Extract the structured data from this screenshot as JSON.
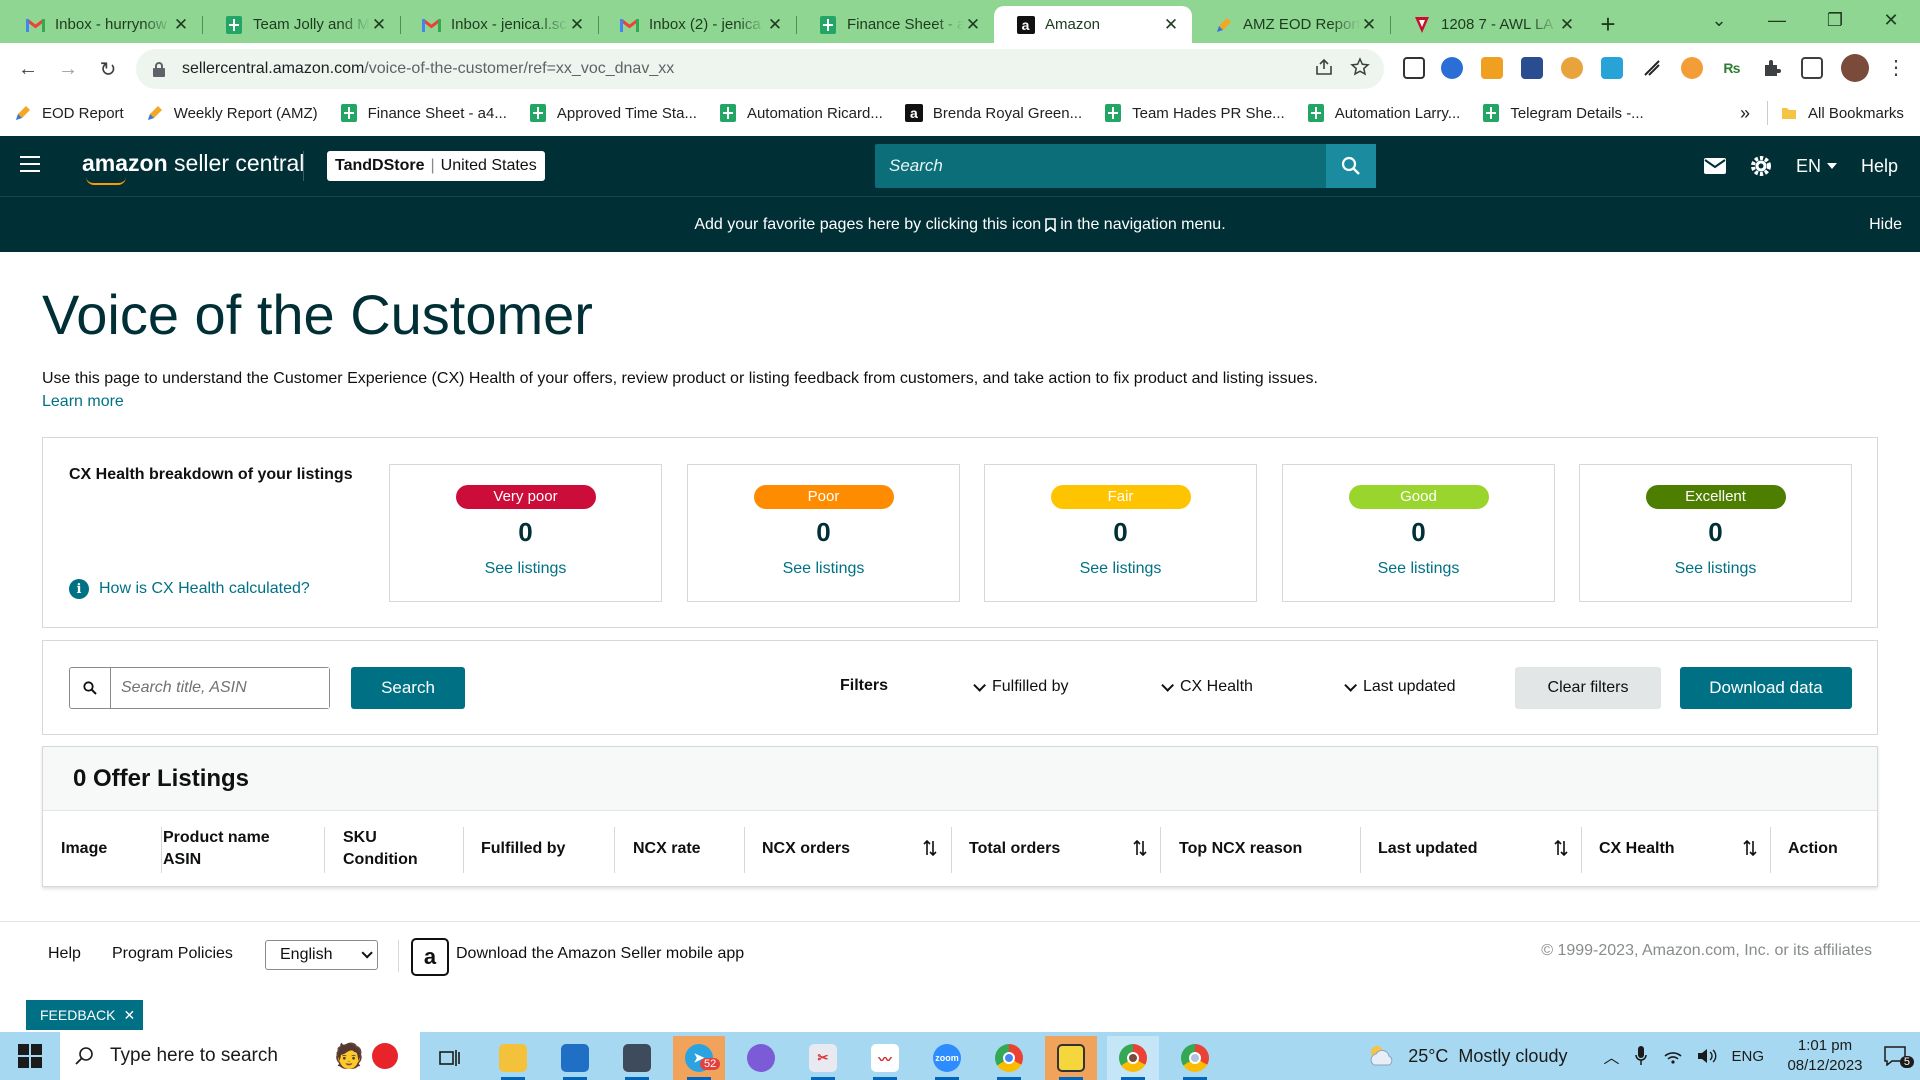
{
  "browser": {
    "tabs": [
      {
        "title": "Inbox - hurrynow",
        "icon": "gmail-icon",
        "active": false
      },
      {
        "title": "Team Jolly and M",
        "icon": "sheets-icon",
        "active": false
      },
      {
        "title": "Inbox - jenica.l.sc",
        "icon": "gmail-icon",
        "active": false
      },
      {
        "title": "Inbox (2) - jenica",
        "icon": "gmail-icon",
        "active": false
      },
      {
        "title": "Finance Sheet - a",
        "icon": "sheets-icon",
        "active": false
      },
      {
        "title": "Amazon",
        "icon": "amazon-icon",
        "active": true
      },
      {
        "title": "AMZ EOD Report",
        "icon": "pen-icon",
        "active": false
      },
      {
        "title": "1208 7 - AWL LA",
        "icon": "shield-icon",
        "active": false
      }
    ],
    "new_tab_label": "+",
    "url_host": "sellercentral.amazon.com",
    "url_path": "/voice-of-the-customer/ref=xx_voc_dnav_xx",
    "bookmarks": [
      {
        "label": "EOD Report",
        "icon": "pen-icon"
      },
      {
        "label": "Weekly Report (AMZ)",
        "icon": "pen-icon"
      },
      {
        "label": "Finance Sheet - a4...",
        "icon": "sheets-icon"
      },
      {
        "label": "Approved Time Sta...",
        "icon": "sheets-icon"
      },
      {
        "label": "Automation Ricard...",
        "icon": "sheets-icon"
      },
      {
        "label": "Brenda Royal Green...",
        "icon": "amazon-icon"
      },
      {
        "label": "Team Hades PR She...",
        "icon": "sheets-icon"
      },
      {
        "label": "Automation Larry...",
        "icon": "sheets-icon"
      },
      {
        "label": "Telegram Details -...",
        "icon": "sheets-icon"
      }
    ],
    "bookmarks_overflow": "»",
    "all_bookmarks": "All Bookmarks"
  },
  "header": {
    "logo_amazon": "amazon",
    "logo_rest": " seller central",
    "store_name": "TandDStore",
    "store_region": "United States",
    "search_placeholder": "Search",
    "language": "EN",
    "help": "Help"
  },
  "banner": {
    "text_before": "Add your favorite pages here by clicking this icon",
    "text_after": "in the navigation menu.",
    "hide": "Hide"
  },
  "page": {
    "title": "Voice of the Customer",
    "description": "Use this page to understand the Customer Experience (CX) Health of your offers, review product or listing feedback from customers, and take action to fix product and listing issues.",
    "learn_more": "Learn more"
  },
  "cx_health": {
    "title": "CX Health breakdown of your listings",
    "how_link": "How is CX Health calculated?",
    "cards": [
      {
        "label": "Very poor",
        "count": "0",
        "link": "See listings",
        "color": "#cc0c39",
        "text_color": "#ffffff"
      },
      {
        "label": "Poor",
        "count": "0",
        "link": "See listings",
        "color": "#ff8c00",
        "text_color": "#ffffff"
      },
      {
        "label": "Fair",
        "count": "0",
        "link": "See listings",
        "color": "#ffc400",
        "text_color": "#ffffff"
      },
      {
        "label": "Good",
        "count": "0",
        "link": "See listings",
        "color": "#9ad52d",
        "text_color": "#ffffff"
      },
      {
        "label": "Excellent",
        "count": "0",
        "link": "See listings",
        "color": "#4d7e00",
        "text_color": "#ffffff"
      }
    ]
  },
  "filters": {
    "search_placeholder": "Search title, ASIN",
    "search_button": "Search",
    "label": "Filters",
    "dropdowns": [
      "Fulfilled by",
      "CX Health",
      "Last updated"
    ],
    "clear": "Clear filters",
    "download": "Download data"
  },
  "listings": {
    "heading": "0 Offer Listings",
    "columns": [
      {
        "line1": "Image",
        "line2": "",
        "sortable": false
      },
      {
        "line1": "Product name",
        "line2": "ASIN",
        "sortable": false
      },
      {
        "line1": "SKU",
        "line2": "Condition",
        "sortable": false
      },
      {
        "line1": "Fulfilled by",
        "line2": "",
        "sortable": false
      },
      {
        "line1": "NCX rate",
        "line2": "",
        "sortable": false
      },
      {
        "line1": "NCX orders",
        "line2": "",
        "sortable": true
      },
      {
        "line1": "Total orders",
        "line2": "",
        "sortable": true
      },
      {
        "line1": "Top NCX reason",
        "line2": "",
        "sortable": false
      },
      {
        "line1": "Last updated",
        "line2": "",
        "sortable": true
      },
      {
        "line1": "CX Health",
        "line2": "",
        "sortable": true
      },
      {
        "line1": "Action",
        "line2": "",
        "sortable": false
      }
    ]
  },
  "footer": {
    "help": "Help",
    "program_policies": "Program Policies",
    "language": "English",
    "app_text": "Download the Amazon Seller mobile app",
    "copyright": "© 1999-2023, Amazon.com, Inc. or its affiliates",
    "feedback": "FEEDBACK"
  },
  "taskbar": {
    "search_placeholder": "Type here to search",
    "telegram_badge": "52",
    "weather_temp": "25°C",
    "weather_desc": "Mostly cloudy",
    "input_lang": "ENG",
    "time": "1:01 pm",
    "date": "08/12/2023",
    "notification_count": "5"
  }
}
